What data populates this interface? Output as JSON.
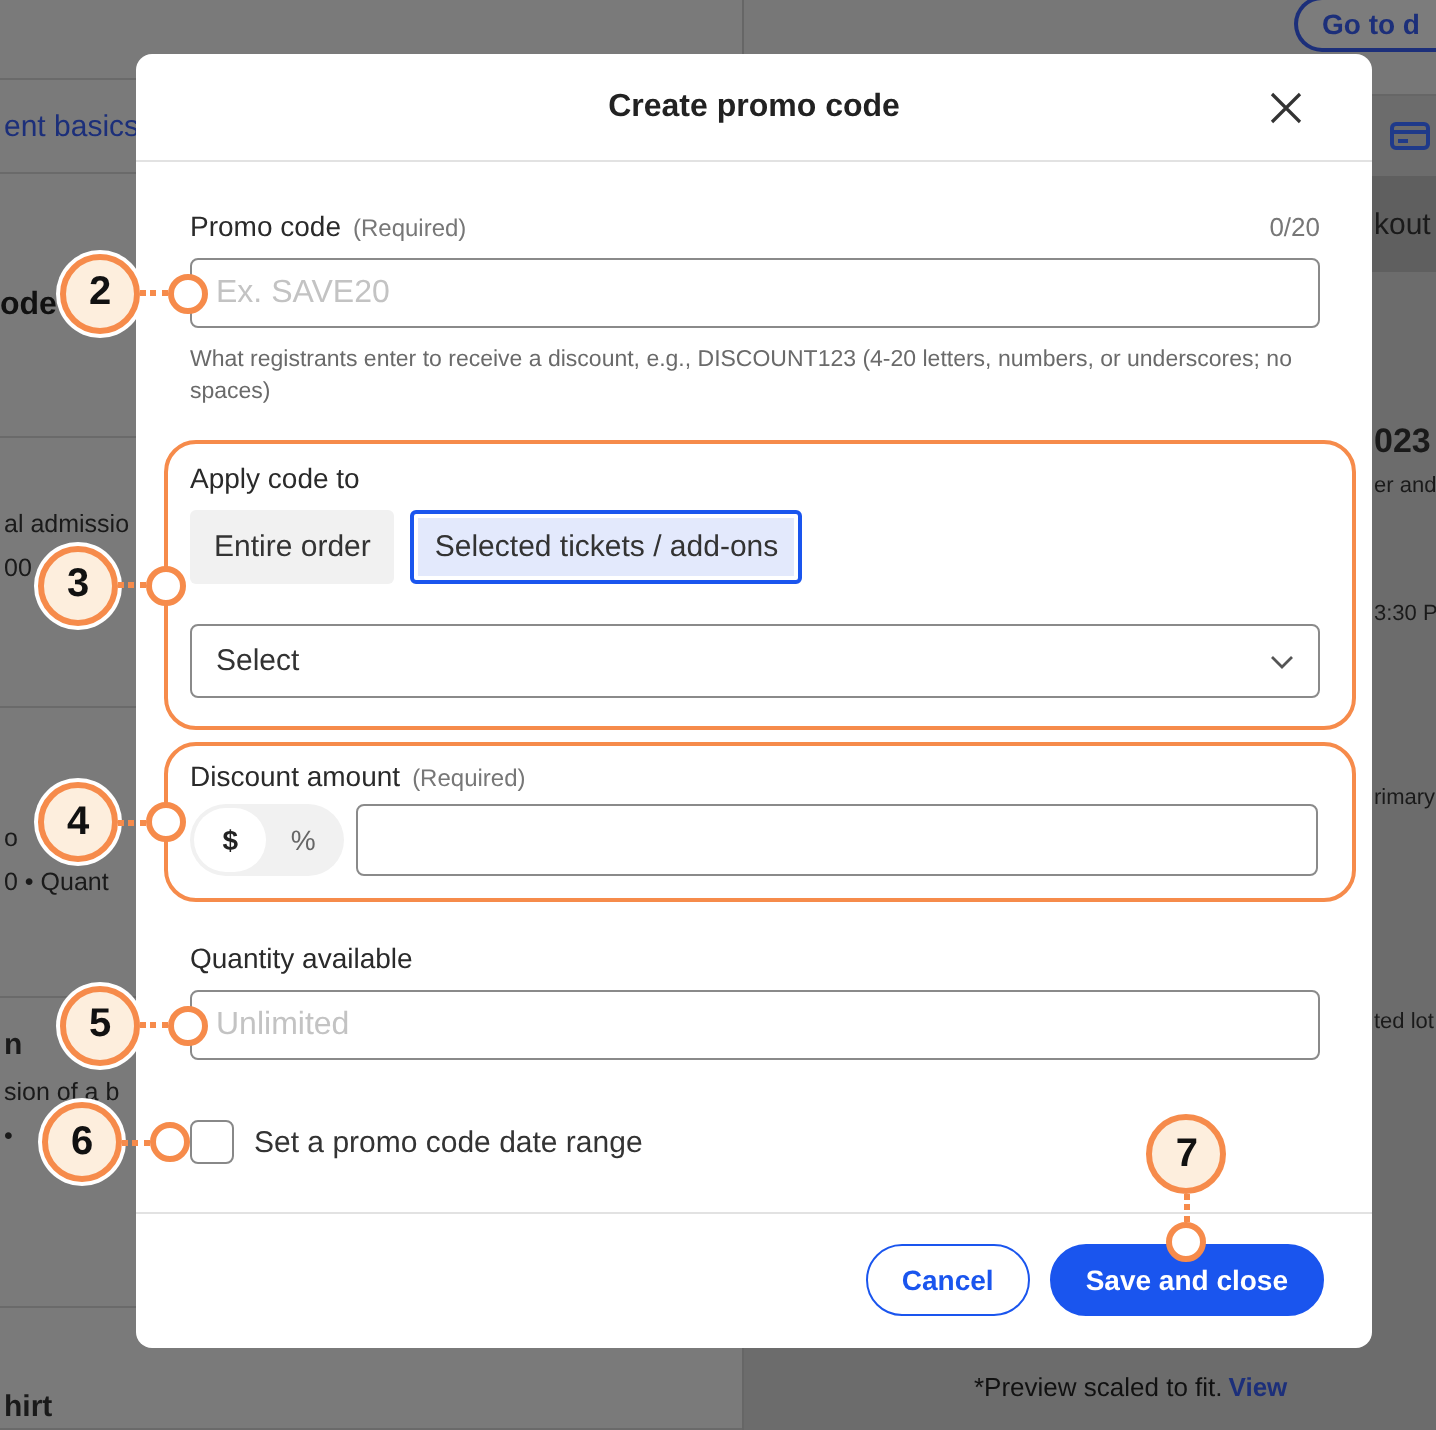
{
  "background": {
    "top_button": "Go to d",
    "left_sections": [
      {
        "lines": [
          {
            "text": "ent basics",
            "kind": "link"
          }
        ]
      },
      {
        "lines": [
          {
            "text": "ode",
            "kind": "heading"
          }
        ]
      },
      {
        "lines": [
          {
            "text": "al admissio",
            "kind": "text"
          },
          {
            "text": "00",
            "kind": "text"
          }
        ]
      },
      {
        "lines": [
          {
            "text": "o",
            "kind": "text"
          },
          {
            "text": "0 • Quant",
            "kind": "text"
          }
        ]
      },
      {
        "lines": [
          {
            "text": "n",
            "kind": "bold"
          },
          {
            "text": "sion of a b",
            "kind": "text"
          },
          {
            "text": "•",
            "kind": "text"
          }
        ]
      },
      {
        "lines": [
          {
            "text": "hirt",
            "kind": "bold"
          }
        ]
      }
    ],
    "right_items": [
      {
        "text": "kout",
        "kind": "band"
      },
      {
        "text": "023",
        "kind": "bold"
      },
      {
        "text": "er and",
        "kind": "text"
      },
      {
        "text": "3:30 P",
        "kind": "text"
      },
      {
        "text": "rimary",
        "kind": "text"
      },
      {
        "text": "ted lot",
        "kind": "text"
      }
    ],
    "preview_note": "*Preview scaled to fit.",
    "preview_link": "View"
  },
  "dialog": {
    "title": "Create promo code",
    "promo_code": {
      "label": "Promo code",
      "required": "(Required)",
      "counter": "0/20",
      "placeholder": "Ex. SAVE20",
      "hint": "What registrants enter to receive a discount, e.g., DISCOUNT123 (4-20 letters, numbers, or underscores; no spaces)",
      "callout": {
        "number": "2"
      }
    },
    "apply_code": {
      "label": "Apply code to",
      "highlighted": true,
      "callout": {
        "number": "3"
      },
      "options": [
        {
          "label": "Entire order",
          "selected": false
        },
        {
          "label": "Selected tickets / add-ons",
          "selected": true
        }
      ],
      "select": {
        "value": "Select"
      }
    },
    "discount": {
      "label": "Discount amount",
      "required": "(Required)",
      "highlighted": true,
      "callout": {
        "number": "4"
      },
      "units": [
        {
          "label": "$",
          "selected": true
        },
        {
          "label": "%",
          "selected": false
        }
      ]
    },
    "quantity": {
      "label": "Quantity available",
      "placeholder": "Unlimited",
      "callout": {
        "number": "5"
      }
    },
    "date_range": {
      "label": "Set a promo code date range",
      "checked": false,
      "callout": {
        "number": "6"
      }
    },
    "buttons": [
      {
        "label": "Cancel",
        "kind": "secondary"
      },
      {
        "label": "Save and close",
        "kind": "primary",
        "callout": {
          "number": "7"
        }
      }
    ]
  }
}
